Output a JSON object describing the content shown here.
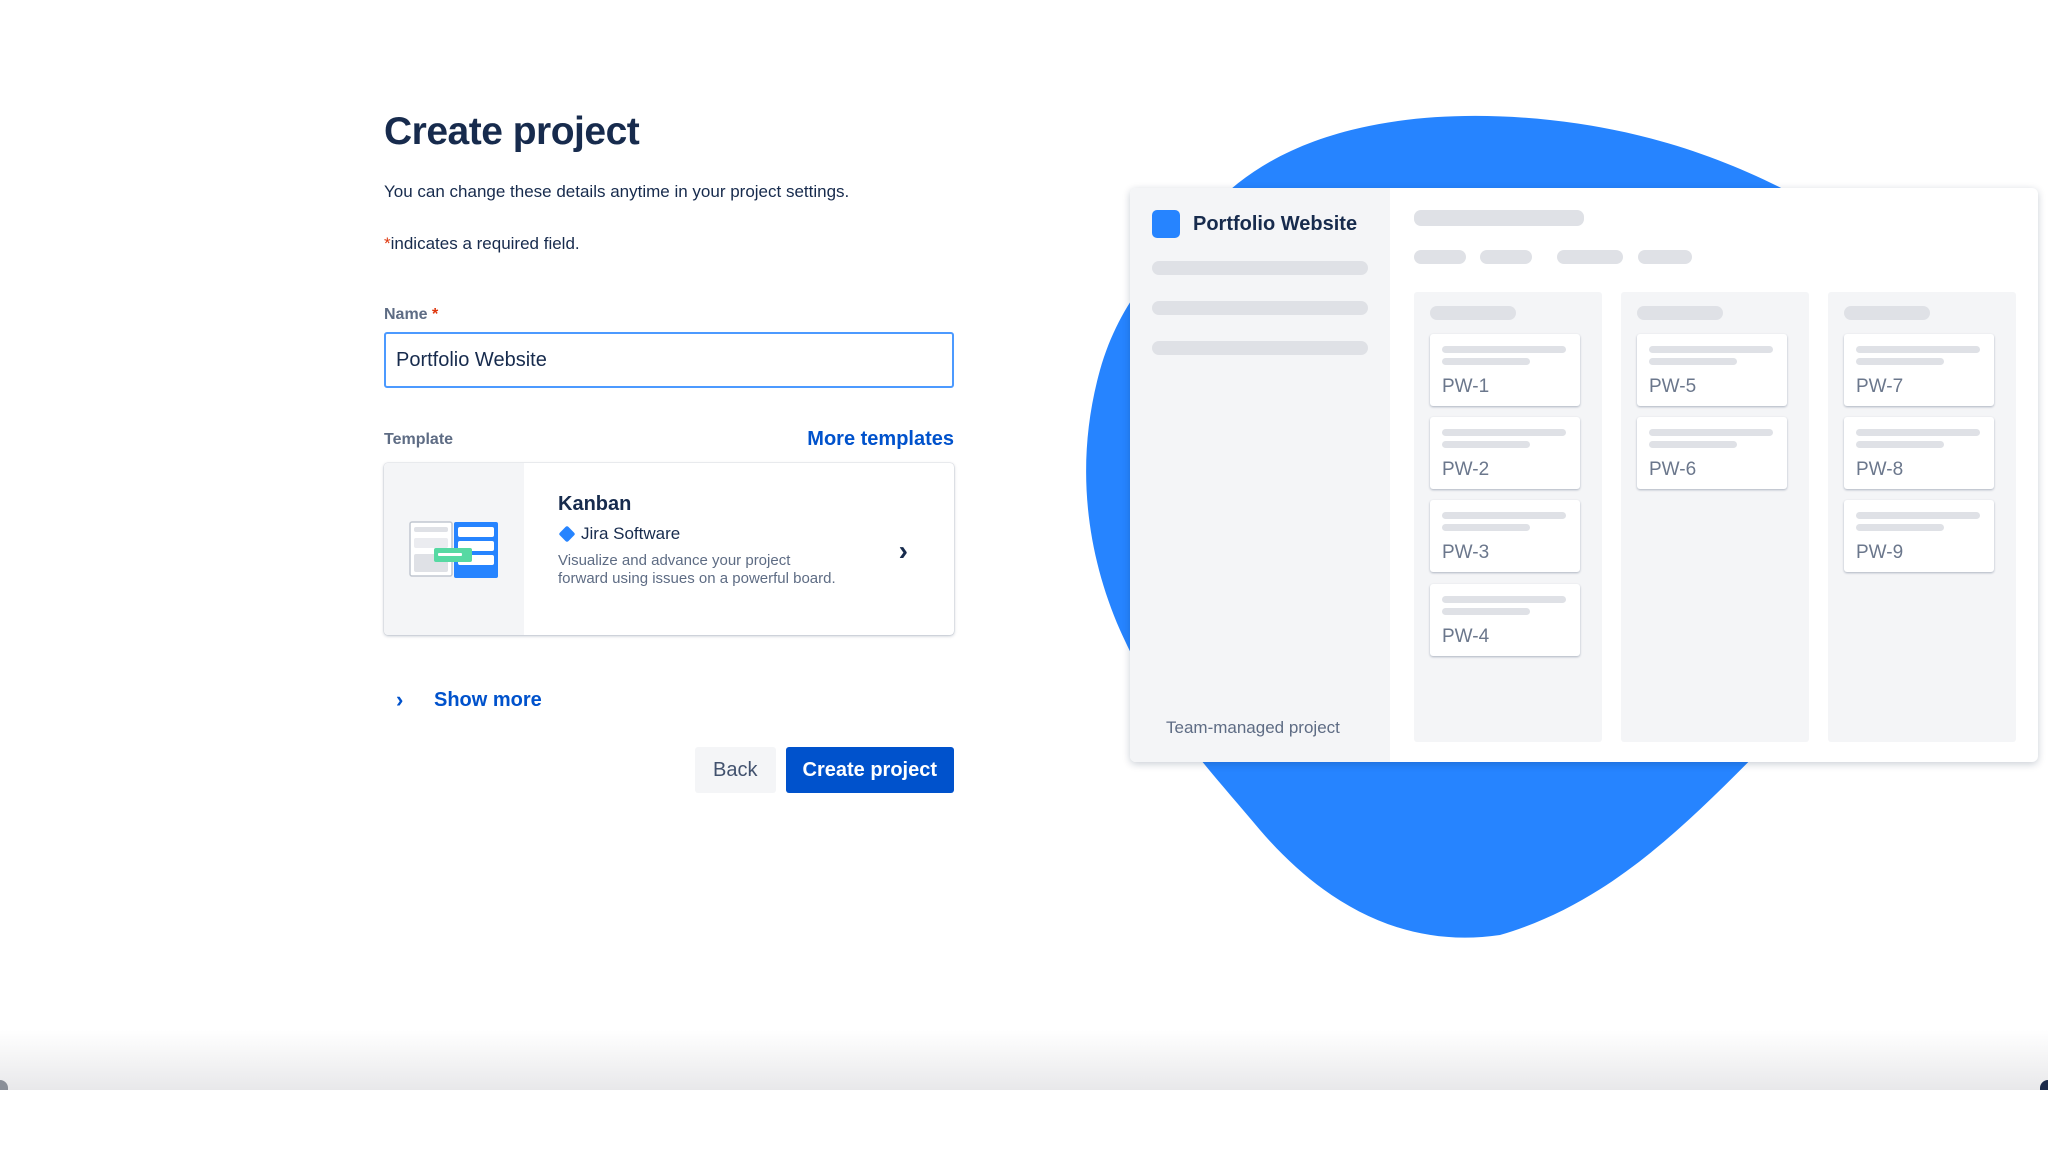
{
  "form": {
    "title": "Create project",
    "subtitle": "You can change these details anytime in your project settings.",
    "required_star": "*",
    "required_note": "indicates a required field.",
    "name_label": "Name",
    "name_value": "Portfolio Website",
    "template_label": "Template",
    "more_templates": "More templates",
    "template": {
      "name": "Kanban",
      "product": "Jira Software",
      "description": "Visualize and advance your project forward using issues on a powerful board."
    },
    "show_more": "Show more",
    "back_label": "Back",
    "create_label": "Create project"
  },
  "preview": {
    "project_name": "Portfolio Website",
    "footer": "Team-managed project",
    "columns": [
      [
        "PW-1",
        "PW-2",
        "PW-3",
        "PW-4"
      ],
      [
        "PW-5",
        "PW-6"
      ],
      [
        "PW-7",
        "PW-8",
        "PW-9"
      ]
    ]
  },
  "colors": {
    "primary": "#0052CC",
    "accent_blue": "#2684FF",
    "blob": "#2684FF",
    "required": "#DE350B",
    "input_focus": "#4C9AFF"
  },
  "icons": {
    "template_arrow": "chevron-right-icon",
    "show_more": "chevron-right-icon",
    "product": "jira-diamond-icon"
  }
}
